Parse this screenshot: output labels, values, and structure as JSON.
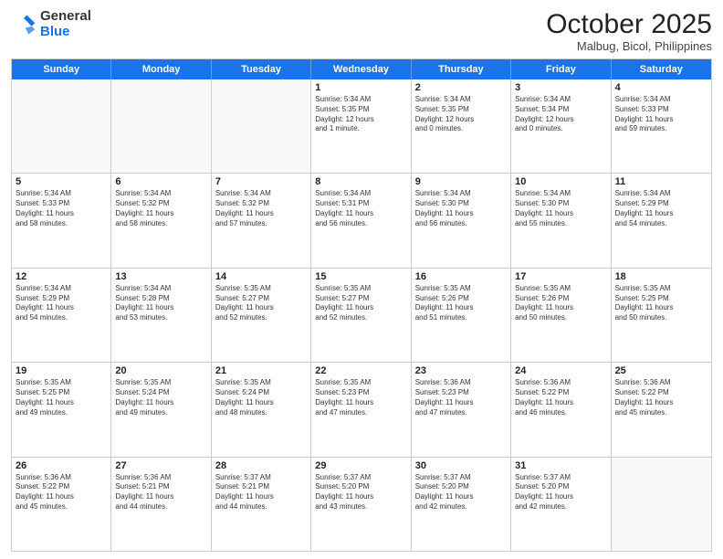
{
  "header": {
    "logo": {
      "line1": "General",
      "line2": "Blue"
    },
    "title": "October 2025",
    "subtitle": "Malbug, Bicol, Philippines"
  },
  "dayNames": [
    "Sunday",
    "Monday",
    "Tuesday",
    "Wednesday",
    "Thursday",
    "Friday",
    "Saturday"
  ],
  "weeks": [
    [
      {
        "date": "",
        "info": ""
      },
      {
        "date": "",
        "info": ""
      },
      {
        "date": "",
        "info": ""
      },
      {
        "date": "1",
        "info": "Sunrise: 5:34 AM\nSunset: 5:35 PM\nDaylight: 12 hours\nand 1 minute."
      },
      {
        "date": "2",
        "info": "Sunrise: 5:34 AM\nSunset: 5:35 PM\nDaylight: 12 hours\nand 0 minutes."
      },
      {
        "date": "3",
        "info": "Sunrise: 5:34 AM\nSunset: 5:34 PM\nDaylight: 12 hours\nand 0 minutes."
      },
      {
        "date": "4",
        "info": "Sunrise: 5:34 AM\nSunset: 5:33 PM\nDaylight: 11 hours\nand 59 minutes."
      }
    ],
    [
      {
        "date": "5",
        "info": "Sunrise: 5:34 AM\nSunset: 5:33 PM\nDaylight: 11 hours\nand 58 minutes."
      },
      {
        "date": "6",
        "info": "Sunrise: 5:34 AM\nSunset: 5:32 PM\nDaylight: 11 hours\nand 58 minutes."
      },
      {
        "date": "7",
        "info": "Sunrise: 5:34 AM\nSunset: 5:32 PM\nDaylight: 11 hours\nand 57 minutes."
      },
      {
        "date": "8",
        "info": "Sunrise: 5:34 AM\nSunset: 5:31 PM\nDaylight: 11 hours\nand 56 minutes."
      },
      {
        "date": "9",
        "info": "Sunrise: 5:34 AM\nSunset: 5:30 PM\nDaylight: 11 hours\nand 56 minutes."
      },
      {
        "date": "10",
        "info": "Sunrise: 5:34 AM\nSunset: 5:30 PM\nDaylight: 11 hours\nand 55 minutes."
      },
      {
        "date": "11",
        "info": "Sunrise: 5:34 AM\nSunset: 5:29 PM\nDaylight: 11 hours\nand 54 minutes."
      }
    ],
    [
      {
        "date": "12",
        "info": "Sunrise: 5:34 AM\nSunset: 5:29 PM\nDaylight: 11 hours\nand 54 minutes."
      },
      {
        "date": "13",
        "info": "Sunrise: 5:34 AM\nSunset: 5:28 PM\nDaylight: 11 hours\nand 53 minutes."
      },
      {
        "date": "14",
        "info": "Sunrise: 5:35 AM\nSunset: 5:27 PM\nDaylight: 11 hours\nand 52 minutes."
      },
      {
        "date": "15",
        "info": "Sunrise: 5:35 AM\nSunset: 5:27 PM\nDaylight: 11 hours\nand 52 minutes."
      },
      {
        "date": "16",
        "info": "Sunrise: 5:35 AM\nSunset: 5:26 PM\nDaylight: 11 hours\nand 51 minutes."
      },
      {
        "date": "17",
        "info": "Sunrise: 5:35 AM\nSunset: 5:26 PM\nDaylight: 11 hours\nand 50 minutes."
      },
      {
        "date": "18",
        "info": "Sunrise: 5:35 AM\nSunset: 5:25 PM\nDaylight: 11 hours\nand 50 minutes."
      }
    ],
    [
      {
        "date": "19",
        "info": "Sunrise: 5:35 AM\nSunset: 5:25 PM\nDaylight: 11 hours\nand 49 minutes."
      },
      {
        "date": "20",
        "info": "Sunrise: 5:35 AM\nSunset: 5:24 PM\nDaylight: 11 hours\nand 49 minutes."
      },
      {
        "date": "21",
        "info": "Sunrise: 5:35 AM\nSunset: 5:24 PM\nDaylight: 11 hours\nand 48 minutes."
      },
      {
        "date": "22",
        "info": "Sunrise: 5:35 AM\nSunset: 5:23 PM\nDaylight: 11 hours\nand 47 minutes."
      },
      {
        "date": "23",
        "info": "Sunrise: 5:36 AM\nSunset: 5:23 PM\nDaylight: 11 hours\nand 47 minutes."
      },
      {
        "date": "24",
        "info": "Sunrise: 5:36 AM\nSunset: 5:22 PM\nDaylight: 11 hours\nand 46 minutes."
      },
      {
        "date": "25",
        "info": "Sunrise: 5:36 AM\nSunset: 5:22 PM\nDaylight: 11 hours\nand 45 minutes."
      }
    ],
    [
      {
        "date": "26",
        "info": "Sunrise: 5:36 AM\nSunset: 5:22 PM\nDaylight: 11 hours\nand 45 minutes."
      },
      {
        "date": "27",
        "info": "Sunrise: 5:36 AM\nSunset: 5:21 PM\nDaylight: 11 hours\nand 44 minutes."
      },
      {
        "date": "28",
        "info": "Sunrise: 5:37 AM\nSunset: 5:21 PM\nDaylight: 11 hours\nand 44 minutes."
      },
      {
        "date": "29",
        "info": "Sunrise: 5:37 AM\nSunset: 5:20 PM\nDaylight: 11 hours\nand 43 minutes."
      },
      {
        "date": "30",
        "info": "Sunrise: 5:37 AM\nSunset: 5:20 PM\nDaylight: 11 hours\nand 42 minutes."
      },
      {
        "date": "31",
        "info": "Sunrise: 5:37 AM\nSunset: 5:20 PM\nDaylight: 11 hours\nand 42 minutes."
      },
      {
        "date": "",
        "info": ""
      }
    ]
  ]
}
